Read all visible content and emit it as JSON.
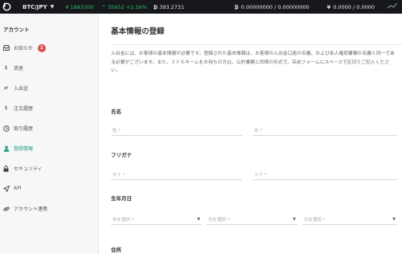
{
  "topbar": {
    "pair": "BTC/JPY",
    "last_price": "¥ 1683300",
    "change": "^ 35652 +2.16%",
    "jp_cap_value": "393.2731",
    "btc_balance": "0.00000000 / 0.00000000",
    "jpy_mark": "¥",
    "jpy_balance": "0.0000 / 0.0000"
  },
  "sidebar": {
    "title": "アカウント",
    "items": [
      {
        "label": "お知らせ",
        "icon": "inbox-icon",
        "badge": "1"
      },
      {
        "label": "資産",
        "icon": "dollar-icon"
      },
      {
        "label": "入出金",
        "icon": "transfer-icon"
      },
      {
        "label": "注文履歴",
        "icon": "dollar-icon"
      },
      {
        "label": "取引履歴",
        "icon": "clock-icon"
      },
      {
        "label": "登録情報",
        "icon": "user-icon",
        "active": true
      },
      {
        "label": "セキュリティ",
        "icon": "lock-icon"
      },
      {
        "label": "API",
        "icon": "send-icon"
      },
      {
        "label": "アカウント連携",
        "icon": "link-icon"
      }
    ]
  },
  "main": {
    "title": "基本情報の登録",
    "description": "入出金には、お客様の基本情報が必要です。登録された基本情報は、お客様の入出金口座の名義、および本人確認書類の名義と同一である必要がございます。また、ミドルネームをお持ちの方は、公的書類と同様の形式で、名前フォームにスペースで区切りご記入ください。",
    "sections": {
      "name": {
        "label": "氏名",
        "last_placeholder": "姓 *",
        "first_placeholder": "名 *"
      },
      "furigana": {
        "label": "フリガナ",
        "last_placeholder": "セイ *",
        "first_placeholder": "メイ *"
      },
      "birthdate": {
        "label": "生年月日",
        "year_placeholder": "年を選択 *",
        "month_placeholder": "月を選択 *",
        "day_placeholder": "日を選択 *"
      },
      "address": {
        "label": "住所"
      }
    }
  },
  "colors": {
    "topbar_bg": "#16181b",
    "accent": "#1f9e7a",
    "up": "#25c26e",
    "badge": "#d9534f"
  }
}
